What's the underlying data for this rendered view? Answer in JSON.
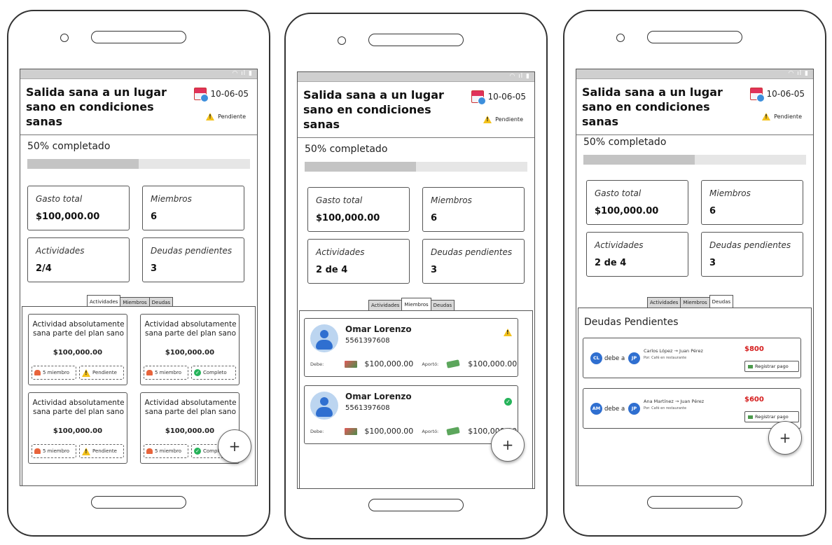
{
  "header": {
    "title": "Salida sana a un lugar sano en condiciones sanas",
    "date": "10-06-05",
    "status": "Pendiente"
  },
  "progress": {
    "label": "50% completado",
    "fraction": 0.5
  },
  "stats": {
    "total_label": "Gasto total",
    "total_value": "$100,000.00",
    "members_label": "Miembros",
    "members_value": "6",
    "activities_label": "Actividades",
    "activities_value_1": "2/4",
    "activities_value_2": "2 de 4",
    "debts_label": "Deudas pendientes",
    "debts_value": "3"
  },
  "tabs": {
    "activities": "Actividades",
    "members": "Miembros",
    "debts": "Deudas"
  },
  "activities": {
    "name": "Actividad absolutamente sana parte del plan sano",
    "amount": "$100,000.00",
    "members_chip": "5 miembro",
    "pending_chip": "Pendiente",
    "complete_chip": "Completo"
  },
  "members": {
    "name": "Omar Lorenzo",
    "phone": "5561397608",
    "debt_label": "Debe:",
    "debt_value": "$100,000.00",
    "paid_label": "Aportó:",
    "paid_value": "$100,000.00"
  },
  "debts": {
    "title": "Deudas Pendientes",
    "owes": "debe a",
    "register": "Registrar pago",
    "concept": "Por: Café en restaurante",
    "items": [
      {
        "from_initials": "CL",
        "to_initials": "JP",
        "line": "Carlos López → Juan Pérez",
        "amount": "$800"
      },
      {
        "from_initials": "AM",
        "to_initials": "JP",
        "line": "Ana Martínez → Juan Pérez",
        "amount": "$600"
      }
    ]
  },
  "fab": "+"
}
